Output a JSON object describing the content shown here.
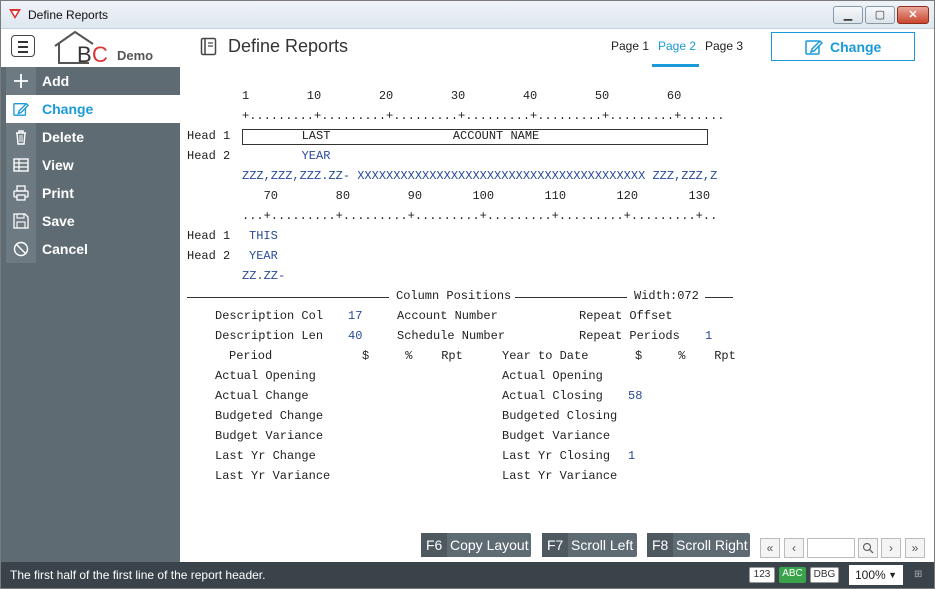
{
  "window": {
    "title": "Define Reports"
  },
  "header": {
    "logo_text": "BC",
    "logo_suffix": "Demo",
    "page_title": "Define Reports",
    "tabs": [
      "Page 1",
      "Page 2",
      "Page 3"
    ],
    "active_tab": "Page 2",
    "mode_button": "Change"
  },
  "sidebar": {
    "items": [
      {
        "label": "Add",
        "icon": "plus-icon"
      },
      {
        "label": "Change",
        "icon": "edit-icon"
      },
      {
        "label": "Delete",
        "icon": "trash-icon"
      },
      {
        "label": "View",
        "icon": "table-icon"
      },
      {
        "label": "Print",
        "icon": "printer-icon"
      },
      {
        "label": "Save",
        "icon": "save-icon"
      },
      {
        "label": "Cancel",
        "icon": "cancel-icon"
      }
    ],
    "active": "Change"
  },
  "layout": {
    "ruler1_numbers": "1        10        20        30        40        50        60",
    "ruler1_ticks": "+.........+.........+.........+.........+.........+.........+......",
    "head1_label": "Head 1",
    "head1_value": "        LAST                 ACCOUNT NAME",
    "head2_label": "Head 2",
    "head2_value": "        YEAR",
    "sample_line": "ZZZ,ZZZ,ZZZ.ZZ- XXXXXXXXXXXXXXXXXXXXXXXXXXXXXXXXXXXXXXXX ZZZ,ZZZ,Z",
    "ruler2_numbers": "   70        80        90       100       110       120       130",
    "ruler2_ticks": "...+.........+.........+.........+.........+.........+.........+..",
    "head1b_label": "Head 1",
    "head1b_value": "THIS",
    "head2b_label": "Head 2",
    "head2b_value": "YEAR",
    "sample_line2": "ZZ.ZZ-"
  },
  "column_positions": {
    "section_title": "Column Positions",
    "width_label": "Width:072",
    "description_col_label": "Description Col",
    "description_col_value": "17",
    "description_len_label": "Description Len",
    "description_len_value": "40",
    "account_number_label": "Account Number",
    "schedule_number_label": "Schedule Number",
    "repeat_offset_label": "Repeat Offset",
    "repeat_periods_label": "Repeat Periods",
    "repeat_periods_value": "1",
    "period_header": "Period",
    "period_cols": "$     %    Rpt",
    "ytd_header": "Year to Date",
    "ytd_cols": "$     %    Rpt",
    "period_rows": [
      "Actual Opening",
      "Actual Change",
      "Budgeted Change",
      "Budget Variance",
      "Last Yr Change",
      "Last Yr Variance"
    ],
    "ytd_rows": [
      "Actual Opening",
      "Actual Closing",
      "Budgeted Closing",
      "Budget Variance",
      "Last Yr Closing",
      "Last Yr Variance"
    ],
    "ytd_actual_closing_value": "58",
    "ytd_last_yr_closing_value": "1"
  },
  "function_keys": [
    {
      "key": "F6",
      "label": "Copy Layout"
    },
    {
      "key": "F7",
      "label": "Scroll Left"
    },
    {
      "key": "F8",
      "label": "Scroll Right"
    }
  ],
  "status": {
    "message": "The first half of the first line of the report header.",
    "badges": [
      "123",
      "ABC",
      "DBG"
    ],
    "zoom": "100%"
  },
  "colors": {
    "accent": "#1a9ad8",
    "sidebar": "#5f6b73",
    "statusbar": "#3a434a",
    "value_blue": "#2a4a9a"
  }
}
